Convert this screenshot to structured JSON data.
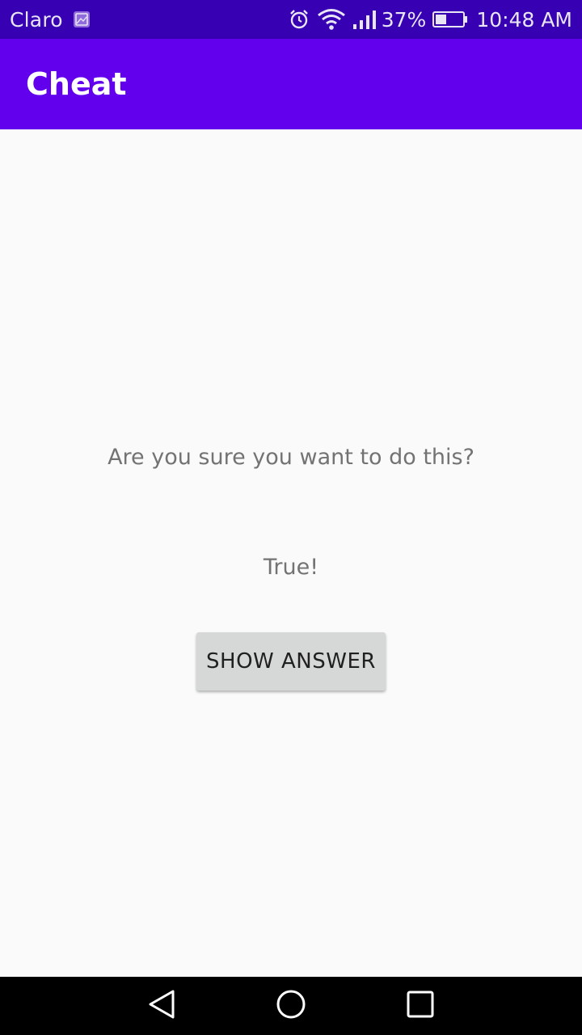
{
  "status_bar": {
    "carrier": "Claro",
    "battery_percent": "37%",
    "time": "10:48 AM",
    "icons": [
      "gallery-icon",
      "alarm-icon",
      "wifi-icon",
      "signal-icon",
      "battery-icon"
    ]
  },
  "app_bar": {
    "title": "Cheat"
  },
  "main": {
    "warning": "Are you sure you want to do this?",
    "answer": "True!",
    "show_answer_label": "SHOW ANSWER"
  },
  "nav_bar": {
    "icons": [
      "back-icon",
      "home-icon",
      "recents-icon"
    ]
  },
  "colors": {
    "status_bar": "#3700b3",
    "app_bar": "#6200ee",
    "background": "#fafafa",
    "button": "#d6d7d7",
    "text_secondary": "#737373"
  }
}
